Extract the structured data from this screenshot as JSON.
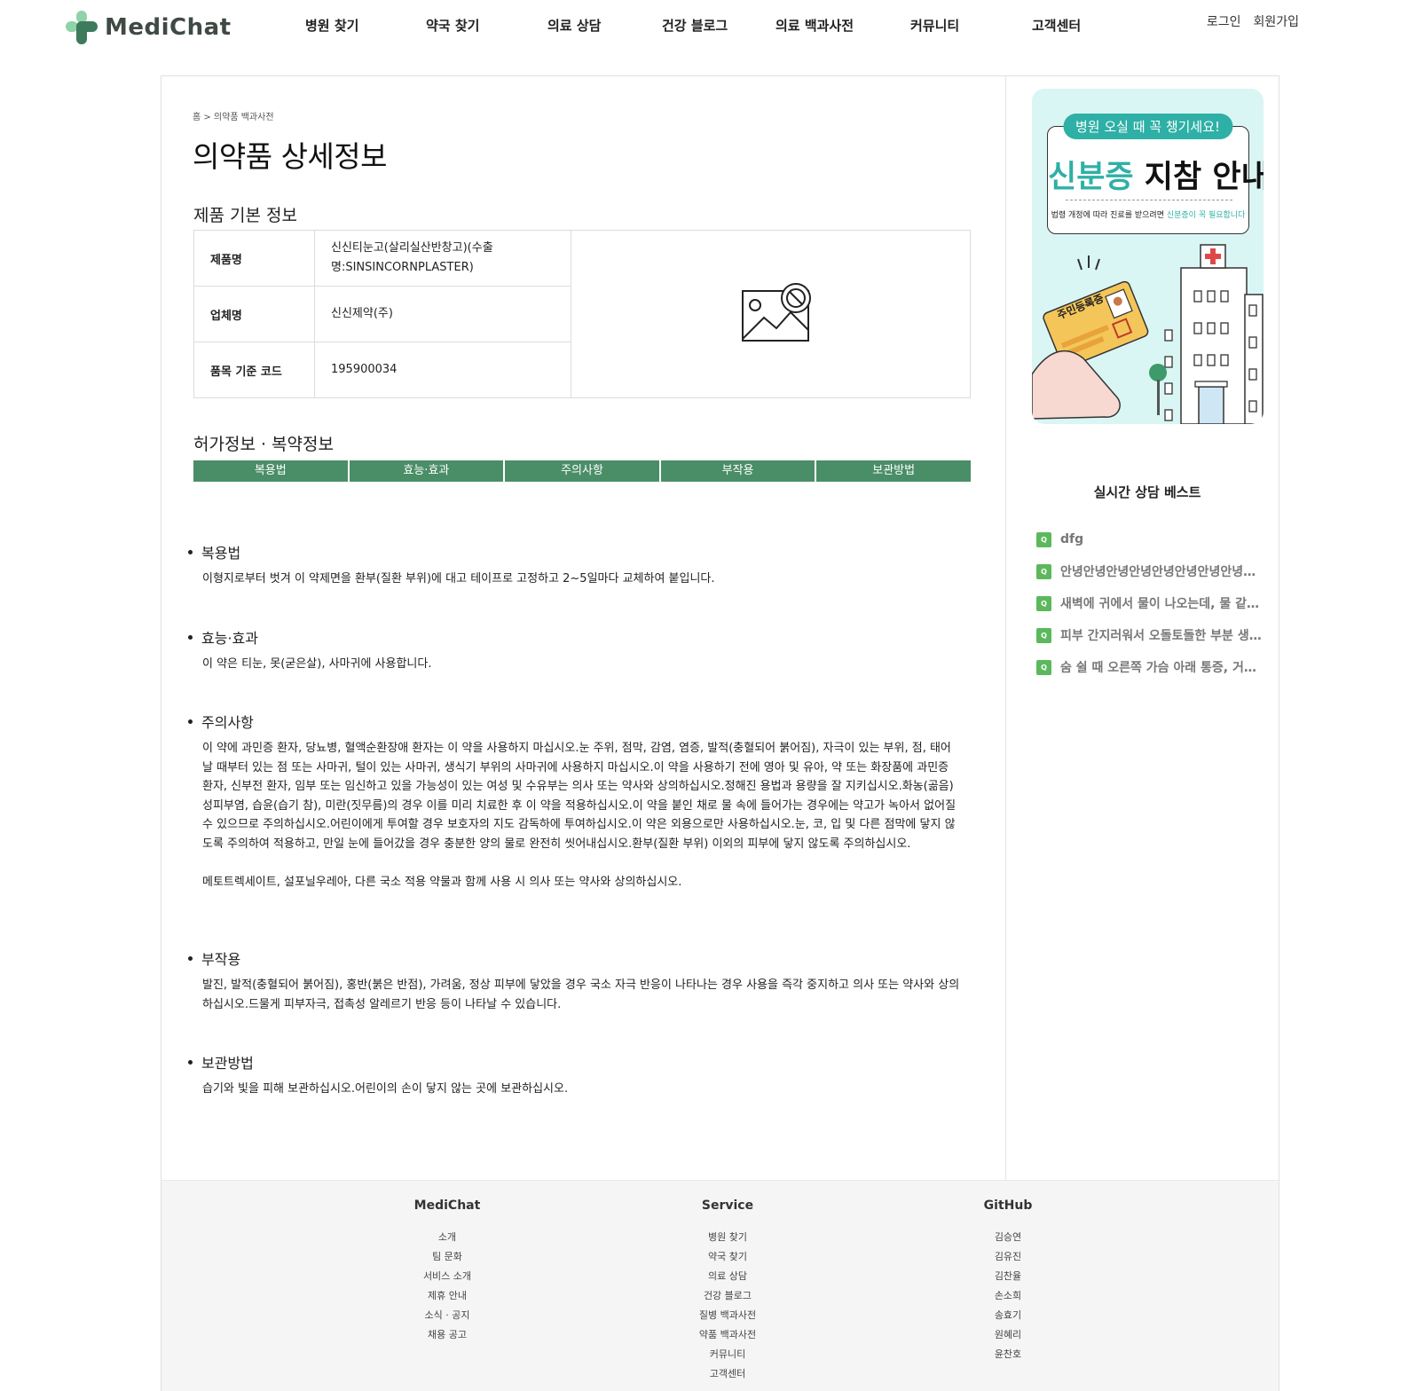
{
  "header": {
    "logo_text": "MediChat",
    "nav": [
      "병원 찾기",
      "약국 찾기",
      "의료 상담",
      "건강 블로그",
      "의료 백과사전",
      "커뮤니티",
      "고객센터"
    ],
    "login": "로그인",
    "signup": "회원가입"
  },
  "breadcrumb": "홈 > 의약품 백과사전",
  "page_title": "의약품 상세정보",
  "basic_info": {
    "title": "제품 기본 정보",
    "rows": [
      {
        "label": "제품명",
        "value": "신신티눈고(살리실산반창고)(수출명:SINSINCORNPLASTER)"
      },
      {
        "label": "업체명",
        "value": "신신제약(주)"
      },
      {
        "label": "품목 기준 코드",
        "value": "195900034"
      }
    ]
  },
  "permit": {
    "title": "허가정보 · 복약정보",
    "tabs": [
      "복용법",
      "효능·효과",
      "주의사항",
      "부작용",
      "보관방법"
    ]
  },
  "sections": [
    {
      "title": "복용법",
      "body": "이형지로부터 벗겨 이 약제면을 환부(질환 부위)에 대고 테이프로 고정하고 2~5일마다 교체하여 붙입니다."
    },
    {
      "title": "효능·효과",
      "body": "이 약은 티눈, 못(굳은살), 사마귀에 사용합니다."
    },
    {
      "title": "주의사항",
      "body": "이 약에 과민증 환자, 당뇨병, 혈액순환장애 환자는 이 약을 사용하지 마십시오.눈 주위, 점막, 감염, 염증, 발적(충혈되어 붉어짐), 자극이 있는 부위, 점, 태어날 때부터 있는 점 또는 사마귀, 털이 있는 사마귀, 생식기 부위의 사마귀에 사용하지 마십시오.이 약을 사용하기 전에 영아 및 유아, 약 또는 화장품에 과민증 환자, 신부전 환자, 임부 또는 임신하고 있을 가능성이 있는 여성 및 수유부는 의사 또는 약사와 상의하십시오.정해진 용법과 용량을 잘 지키십시오.화농(곪음)성피부염, 습윤(습기 참), 미란(짓무름)의 경우 이를 미리 치료한 후 이 약을 적용하십시오.이 약을 붙인 채로 물 속에 들어가는 경우에는 약고가 녹아서 없어질 수 있으므로 주의하십시오.어린이에게 투여할 경우 보호자의 지도 감독하에 투여하십시오.이 약은 외용으로만 사용하십시오.눈, 코, 입 및 다른 점막에 닿지 않도록 주의하여 적용하고, 만일 눈에 들어갔을 경우 충분한 양의 물로 완전히 씻어내십시오.환부(질환 부위) 이외의 피부에 닿지 않도록 주의하십시오.\n\n메토트렉세이트, 설포닐우레아, 다른 국소 적용 약물과 함께 사용 시 의사 또는 약사와 상의하십시오."
    },
    {
      "title": "부작용",
      "body": "발진, 발적(충혈되어 붉어짐), 홍반(붉은 반점), 가려움, 정상 피부에 닿았을 경우 국소 자극 반응이 나타나는 경우 사용을 즉각 중지하고 의사 또는 약사와 상의하십시오.드물게 피부자극, 접촉성 알레르기 반응 등이 나타날 수 있습니다."
    },
    {
      "title": "보관방법",
      "body": "습기와 빛을 피해 보관하십시오.어린이의 손이 닿지 않는 곳에 보관하십시오."
    }
  ],
  "banner": {
    "pill": "병원 오실 때 꼭 챙기세요!",
    "title_teal": "신분증",
    "title_dark": " 지참 안내",
    "sub_dark": "법령 개정에 따라 진료를 받으려면 ",
    "sub_teal": "신분증이 꼭 필요합니다",
    "card_text": "주민등록증"
  },
  "best": {
    "title": "실시간 상담 베스트",
    "badge": "Q",
    "items": [
      "dfg",
      "안녕안녕안녕안녕안녕안녕안녕안녕안녕",
      "새벽에 귀에서 물이 나오는데, 물 같은 액체가",
      "피부 간지러워서 오돌토돌한 부분 생기는데",
      "숨 쉴 때 오른쪽 가슴 아래 통증, 거북목"
    ]
  },
  "footer": {
    "columns": [
      {
        "title": "MediChat",
        "items": [
          "소개",
          "팀 문화",
          "서비스 소개",
          "제휴 안내",
          "소식 · 공지",
          "채용 공고"
        ]
      },
      {
        "title": "Service",
        "items": [
          "병원 찾기",
          "약국 찾기",
          "의료 상담",
          "건강 블로그",
          "질병 백과사전",
          "약품 백과사전",
          "커뮤니티",
          "고객센터"
        ]
      },
      {
        "title": "GitHub",
        "items": [
          "김승연",
          "김유진",
          "김찬율",
          "손소희",
          "송효기",
          "원혜리",
          "윤찬호"
        ]
      }
    ]
  },
  "colors": {
    "brand_green": "#4a8e68",
    "teal": "#2eb0a6",
    "badge_green": "#5cb85c"
  },
  "icons": {
    "logo": "cross-logo-icon",
    "image_placeholder": "no-image-icon"
  }
}
